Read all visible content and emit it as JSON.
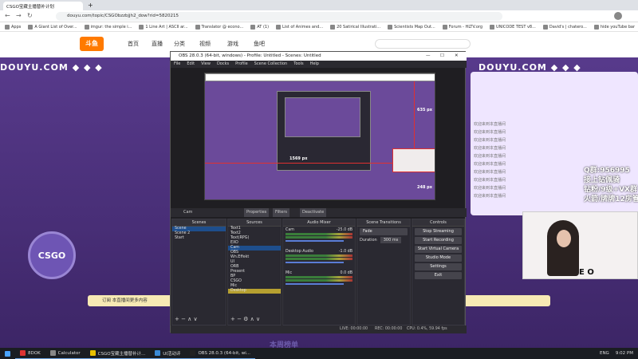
{
  "browser": {
    "tabs": [
      {
        "label": "CSGO宝藏主播替补计划"
      }
    ],
    "url": "douyu.com/topic/CSGObzzbjjh2_dow?rid=5820215",
    "bookmarks": [
      "Apps",
      "A Giant List of Over...",
      "imgur: the simple i...",
      "1 Line Art | ASCII ar...",
      "Translator @ econo...",
      "AT (1)",
      "List of Animes and...",
      "20 Satirical Illustrati...",
      "Scientists Map Out...",
      "Forum - HLTV.org",
      "UNICODE TEST v8...",
      "David's | chatero...",
      "hide youTube bar"
    ]
  },
  "site": {
    "nav": [
      "首页",
      "直播",
      "分类",
      "视频",
      "游戏",
      "鱼吧"
    ],
    "tile": "DOUYU.COM ◆ ◆ ◆",
    "tile2": "DOUYU.COM ◆ ◆ ◆",
    "chat_lines": [
      "欢迎来到本直播间",
      "欢迎来到本直播间",
      "欢迎来到本直播间",
      "欢迎来到本直播间",
      "欢迎来到本直播间",
      "欢迎来到本直播间",
      "欢迎来到本直播间",
      "欢迎来到本直播间",
      "欢迎来到本直播间",
      "欢迎来到本直播间"
    ],
    "banner": [
      "Q群:956995",
      "接上钻佩骑",
      "钻粉/9级+VX群",
      "火箭/牌牌12房管"
    ],
    "webcam_label": "E O",
    "logo": "CSGO",
    "follow": "订阅 本直播间更多内容",
    "ranking": "本周榜单"
  },
  "obs": {
    "title": "OBS 28.0.3 (64-bit, windows) - Profile: Untitled - Scenes: Untitled",
    "menu": [
      "File",
      "Edit",
      "View",
      "Docks",
      "Profile",
      "Scene Collection",
      "Tools",
      "Help"
    ],
    "overlay_labels": [
      "635 px",
      "1569 px",
      "248 px"
    ],
    "source_bar": {
      "name": "Cam",
      "properties": "Properties",
      "filters": "Filters",
      "deactivate": "Deactivate"
    },
    "scenes": {
      "header": "Scenes",
      "items": [
        "Scene",
        "Scene 2",
        "Start"
      ]
    },
    "sources": {
      "header": "Sources",
      "items": [
        "Text1",
        "Text2",
        "Text(RPG)",
        "EXO",
        "Cam",
        "OBS",
        "Wn.Effekt",
        "UI",
        "ORB",
        "Present",
        "BP",
        "CSGO",
        "Mic",
        "Desktop"
      ]
    },
    "mixer": {
      "header": "Audio Mixer",
      "tracks": [
        {
          "name": "Cam",
          "db": "-25.0 dB"
        },
        {
          "name": "Desktop Audio",
          "db": "-1.0 dB"
        },
        {
          "name": "Mic",
          "db": "0.0 dB"
        }
      ]
    },
    "transitions": {
      "header": "Scene Transitions",
      "type": "Fade",
      "duration_label": "Duration",
      "duration": "300 ms"
    },
    "controls": {
      "header": "Controls",
      "buttons": [
        "Stop Streaming",
        "Start Recording",
        "Start Virtual Camera",
        "Studio Mode",
        "Settings",
        "Exit"
      ]
    },
    "status": {
      "live": "LIVE: 00:00:00",
      "rec": "REC: 00:00:00",
      "cpu": "CPU: 0.4%, 59.94 fps"
    }
  },
  "taskbar": {
    "items": [
      "8DOK",
      "Calculator",
      "CSGO宝藏主播替补计...",
      "UI活动评",
      "OBS 28.0.3 (64-bit, wi..."
    ],
    "lang": "ENG",
    "time": "9:02 PM"
  }
}
